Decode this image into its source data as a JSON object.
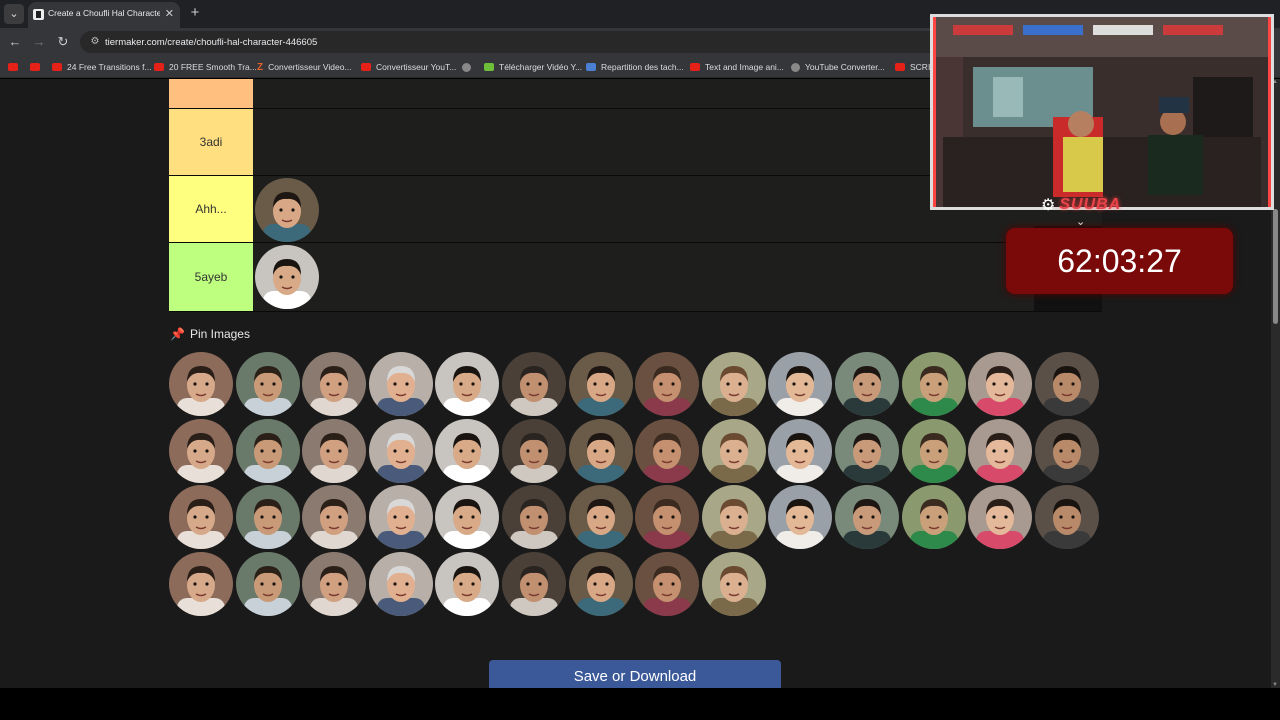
{
  "browser": {
    "tab_title": "Create a Choufli Hal Character Tier List",
    "tab_close": "✕",
    "new_tab": "+",
    "url": "tiermaker.com/create/choufli-hal-character-446605"
  },
  "bookmarks": [
    {
      "label": "",
      "icon": "youtube-icon"
    },
    {
      "label": "",
      "icon": "youtube-icon"
    },
    {
      "label": "24 Free Transitions f...",
      "icon": "youtube-icon"
    },
    {
      "label": "20 FREE Smooth Tra...",
      "icon": "youtube-icon"
    },
    {
      "label": "Convertisseur Video...",
      "icon": "z-icon"
    },
    {
      "label": "Convertisseur YouT...",
      "icon": "youtube-icon"
    },
    {
      "label": "",
      "icon": "globe-icon"
    },
    {
      "label": "Télécharger Vidéo Y...",
      "icon": "download-icon"
    },
    {
      "label": "Repartition des tach...",
      "icon": "docs-icon"
    },
    {
      "label": "Text and Image ani...",
      "icon": "youtube-icon"
    },
    {
      "label": "YouTube Converter...",
      "icon": "globe-icon"
    },
    {
      "label": "SCRI",
      "icon": "youtube-icon"
    }
  ],
  "tiers": [
    {
      "label": "",
      "color": "#ffbf7f",
      "items": 0
    },
    {
      "label": "3adi",
      "color": "#ffdf80",
      "items": 0
    },
    {
      "label": "Ahh...",
      "color": "#ffff7f",
      "items": 1
    },
    {
      "label": "5ayeb",
      "color": "#bfff7f",
      "items": 1
    }
  ],
  "pin_section": {
    "title": "Pin Images"
  },
  "bank": {
    "count": 51
  },
  "save_button": "Save or Download",
  "stream_overlay": {
    "logo": "SUUBA",
    "timer": "62:03:27"
  },
  "colors": {
    "page_bg": "#1a1a1a",
    "save_button": "#3b5998",
    "timer_bg": "#7a0a0a"
  }
}
